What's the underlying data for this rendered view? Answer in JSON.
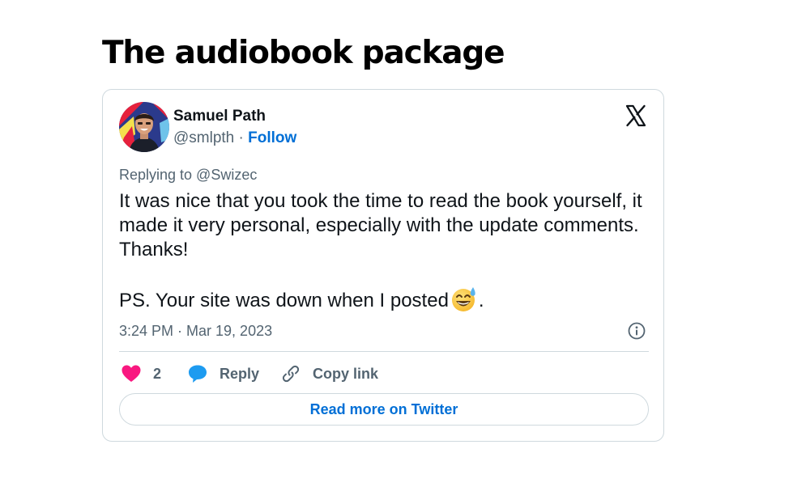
{
  "page": {
    "title": "The audiobook package"
  },
  "tweet": {
    "author_name": "Samuel Path",
    "handle": "@smlpth",
    "separator": " · ",
    "follow_label": "Follow",
    "reply_context": "Replying to @Swizec",
    "body_paragraph_1": "It was nice that you took the time to read the book yourself, it made it very personal, especially with the update comments. Thanks!",
    "body_paragraph_2_text": "PS. Your site was down when I posted",
    "body_paragraph_2_end": ".",
    "emoji_icon": "sweat-smile-emoji-icon",
    "timestamp": "3:24 PM · Mar 19, 2023",
    "logo_icon": "x-logo-icon",
    "info_icon": "info-icon",
    "actions": {
      "like_count": "2",
      "like_icon": "heart-icon",
      "reply_label": "Reply",
      "reply_icon": "speech-bubble-icon",
      "copy_label": "Copy link",
      "copy_icon": "link-icon"
    },
    "read_more_label": "Read more on Twitter"
  },
  "colors": {
    "text_primary": "#0f1419",
    "text_secondary": "#536471",
    "link_blue": "#006fd6",
    "border": "#cfd9de",
    "like_pink": "#f91880",
    "reply_blue": "#1d9bf0"
  }
}
